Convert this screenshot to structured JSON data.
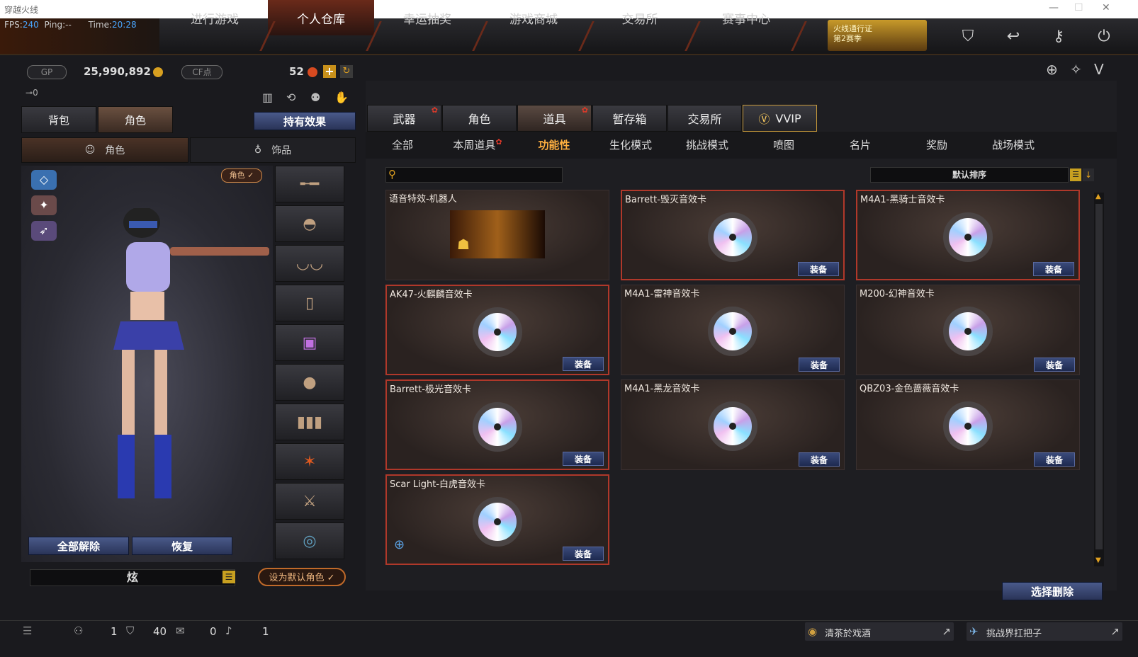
{
  "window": {
    "title": "穿越火线"
  },
  "hud": {
    "fps_label": "FPS:",
    "fps_value": "240",
    "ping": "Ping:--",
    "time_label": "Time:",
    "time_value": "20:28"
  },
  "nav": {
    "tabs": [
      "进行游戏",
      "个人仓库",
      "幸运抽奖",
      "游戏商城",
      "交易所",
      "赛事中心"
    ],
    "active_index": 1,
    "pass_line1": "火线通行证",
    "pass_line2": "第2赛季",
    "icons": [
      "shield-icon",
      "back-icon",
      "key-icon",
      "power-icon"
    ]
  },
  "currency": {
    "gp_label": "GP",
    "gp_value": "25,990,892",
    "cf_label": "CF点",
    "cf_value": "52",
    "plus": "+",
    "key_count": "0"
  },
  "left": {
    "tabs": [
      "背包",
      "角色"
    ],
    "active_tab": 1,
    "effect_button": "持有效果",
    "subtabs": [
      "角色",
      "饰品"
    ],
    "role_badge": "角色 ✓",
    "unequip_all": "全部解除",
    "restore": "恢复",
    "name_value": "炫",
    "set_default": "设为默认角色 ✓"
  },
  "right": {
    "categories": [
      "武器",
      "角色",
      "道具",
      "暂存箱",
      "交易所",
      "VVIP"
    ],
    "active_category": 2,
    "filters": [
      "全部",
      "本周道具",
      "功能性",
      "生化模式",
      "挑战模式",
      "喷图",
      "名片",
      "奖励",
      "战场模式"
    ],
    "active_filter": 2,
    "search_placeholder": "",
    "sort_label": "默认排序",
    "select_delete": "选择删除",
    "equip_label": "装备",
    "items": [
      {
        "name": "语音特效-机器人",
        "equip": false,
        "selected": false
      },
      {
        "name": "Barrett-毁灭音效卡",
        "equip": true,
        "selected": true
      },
      {
        "name": "M4A1-黑骑士音效卡",
        "equip": true,
        "selected": true
      },
      {
        "name": "AK47-火麒麟音效卡",
        "equip": true,
        "selected": true
      },
      {
        "name": "M4A1-雷神音效卡",
        "equip": true,
        "selected": false
      },
      {
        "name": "M200-幻神音效卡",
        "equip": true,
        "selected": false
      },
      {
        "name": "Barrett-极光音效卡",
        "equip": true,
        "selected": true
      },
      {
        "name": "M4A1-黑龙音效卡",
        "equip": true,
        "selected": false
      },
      {
        "name": "QBZ03-金色蔷薇音效卡",
        "equip": true,
        "selected": false
      },
      {
        "name": "Scar Light-白虎音效卡",
        "equip": true,
        "selected": true
      }
    ]
  },
  "bottom": {
    "friends": "1",
    "clan": "40",
    "chat": "0",
    "volume": "1",
    "news1": "清茶於戏酒",
    "news2": "挑战界扛把子"
  },
  "colors": {
    "accent_orange": "#ffb040",
    "selected_border": "#b0382a",
    "equip_blue": "#2a3458"
  }
}
